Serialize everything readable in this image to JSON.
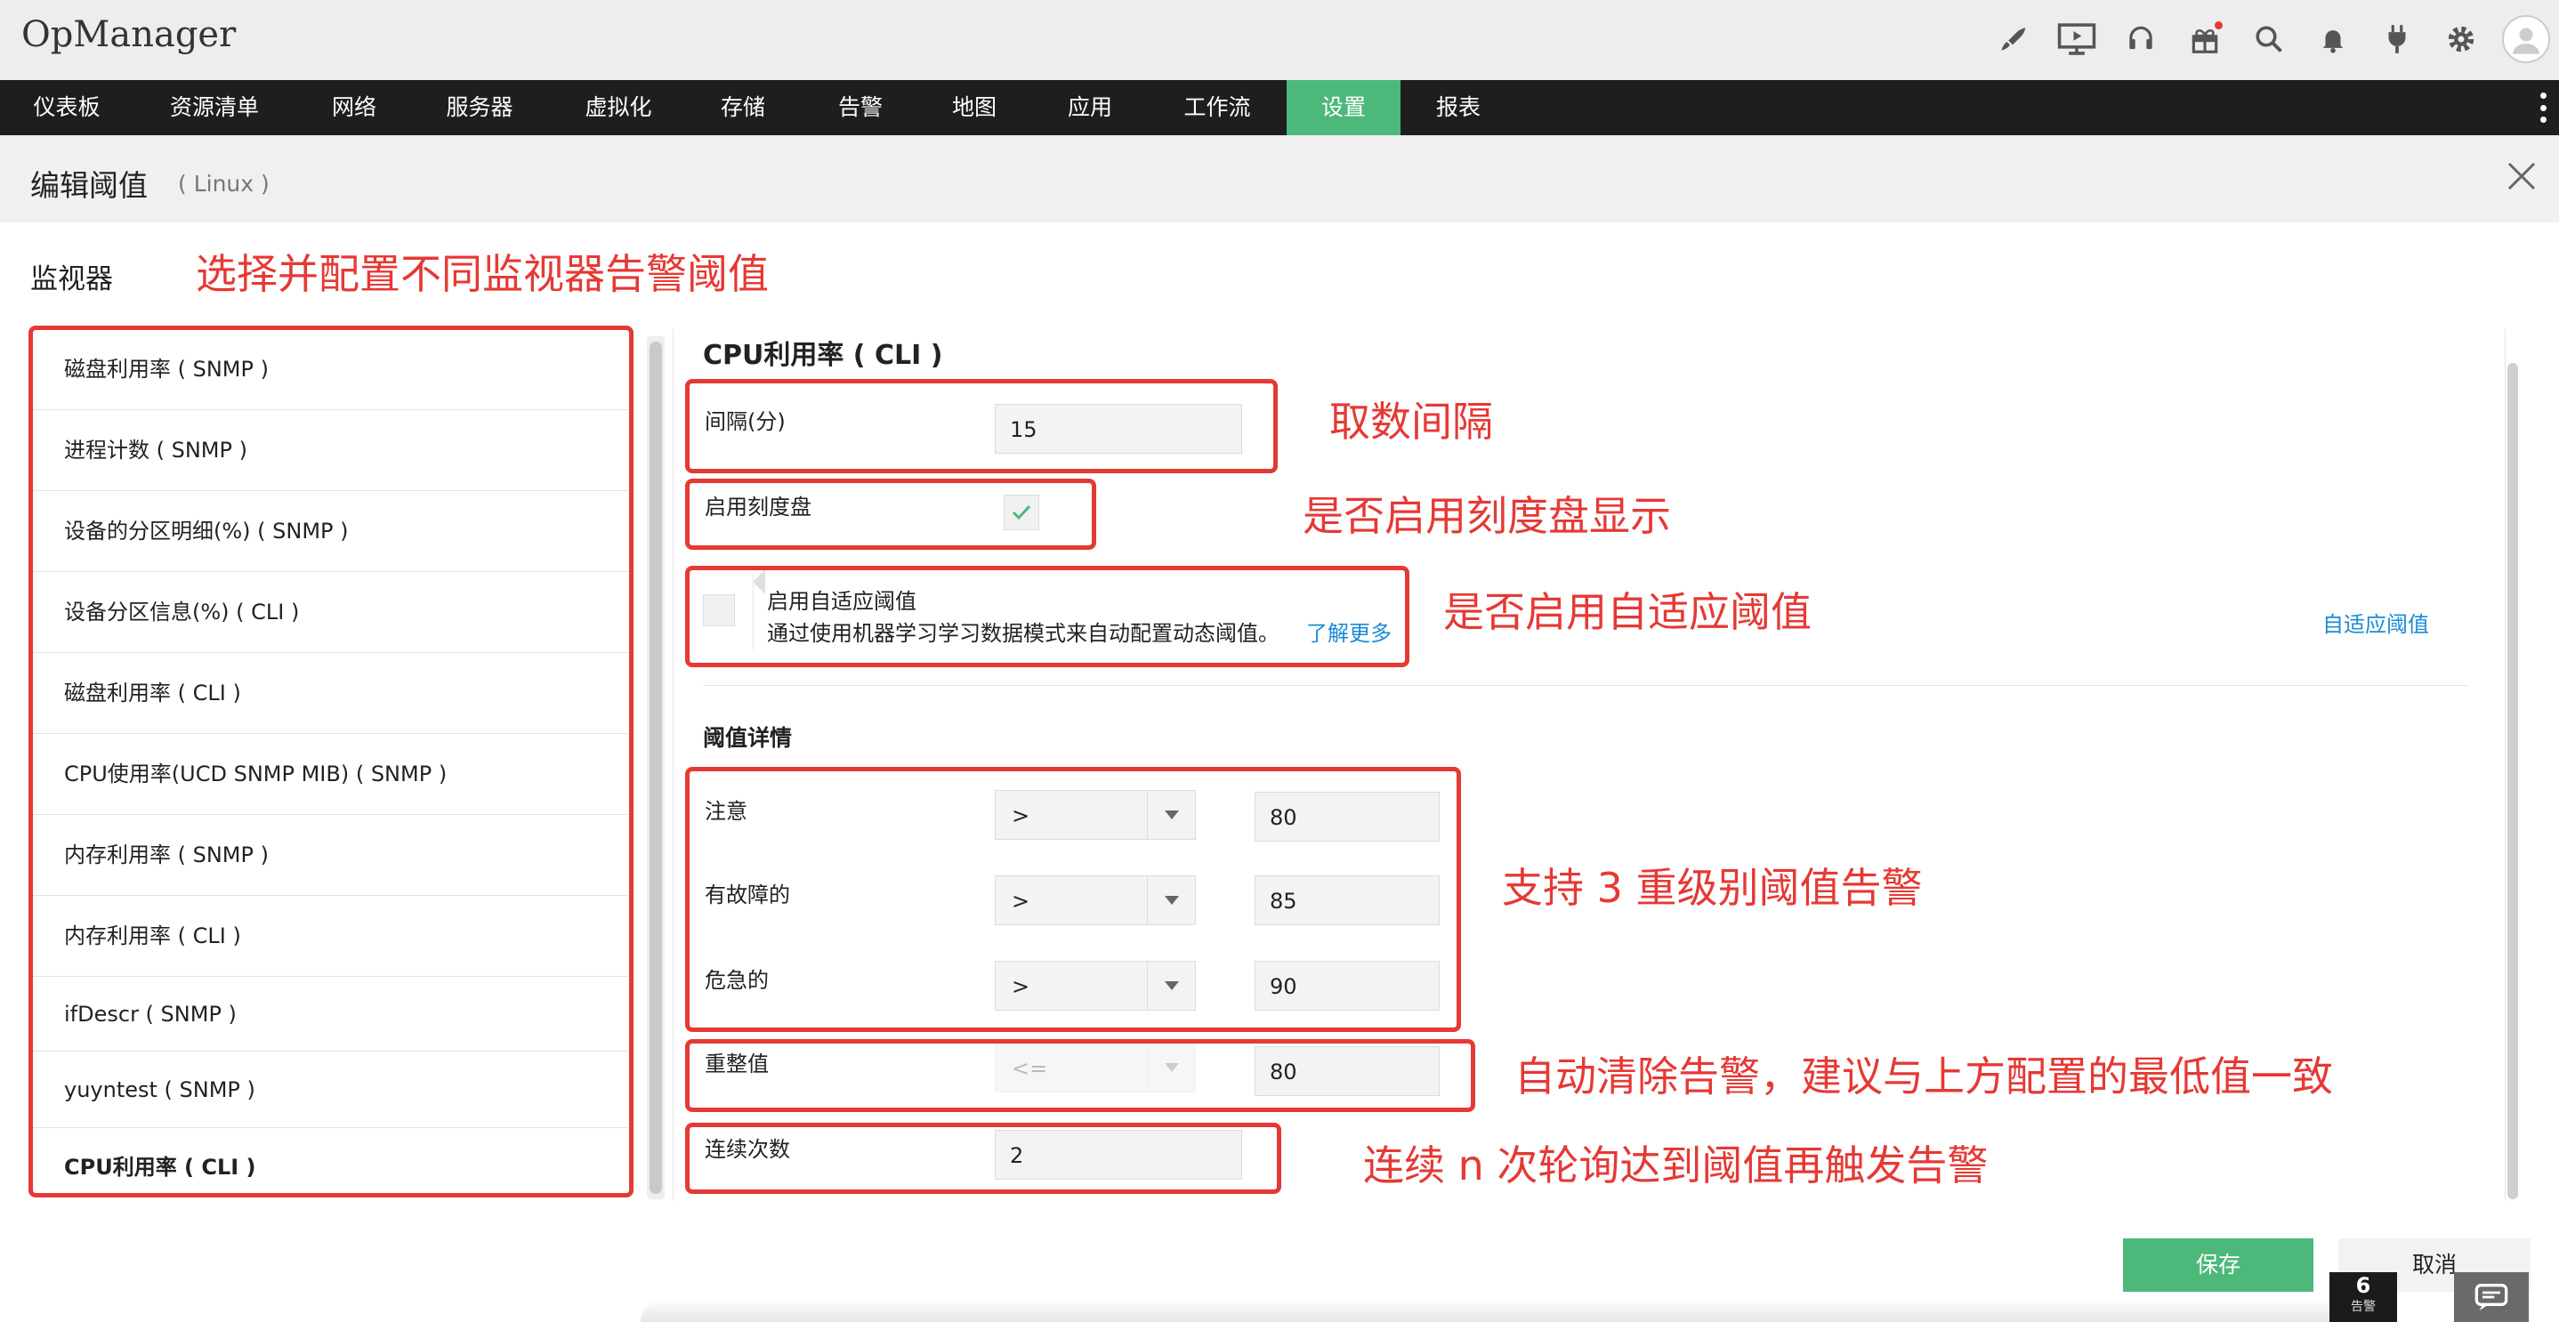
{
  "app": {
    "name": "OpManager"
  },
  "topbar": {
    "icons": [
      "rocket-icon",
      "presentation-icon",
      "headset-icon",
      "gift-icon",
      "search-icon",
      "bell-icon",
      "plug-icon",
      "gear-icon",
      "user-avatar-icon"
    ]
  },
  "nav": {
    "items": [
      "仪表板",
      "资源清单",
      "网络",
      "服务器",
      "虚拟化",
      "存储",
      "告警",
      "地图",
      "应用",
      "工作流",
      "设置",
      "报表"
    ],
    "active": "设置"
  },
  "header": {
    "title": "编辑阈值",
    "subtitle": "( Linux )"
  },
  "monitors": {
    "title": "监视器",
    "items": [
      "磁盘利用率 ( SNMP )",
      "进程计数 ( SNMP )",
      "设备的分区明细(%) ( SNMP )",
      "设备分区信息(%) ( CLI )",
      "磁盘利用率 ( CLI )",
      "CPU使用率(UCD SNMP MIB) ( SNMP )",
      "内存利用率 ( SNMP )",
      "内存利用率 ( CLI )",
      "ifDescr ( SNMP )",
      "yuyntest ( SNMP )",
      "CPU利用率 ( CLI )"
    ],
    "selected": "CPU利用率 ( CLI )"
  },
  "form": {
    "title": "CPU利用率 ( CLI )",
    "interval_label": "间隔(分)",
    "interval_value": "15",
    "dial_label": "启用刻度盘",
    "adaptive_label": "启用自适应阈值",
    "adaptive_desc": "通过使用机器学习学习数据模式来自动配置动态阈值。",
    "learn_more": "了解更多",
    "adaptive_link": "自适应阈值",
    "threshold_title": "阈值详情",
    "attention_label": "注意",
    "attention_op": ">",
    "attention_value": "80",
    "trouble_label": "有故障的",
    "trouble_op": ">",
    "trouble_value": "85",
    "critical_label": "危急的",
    "critical_op": ">",
    "critical_value": "90",
    "rearm_label": "重整值",
    "rearm_op": "<=",
    "rearm_value": "80",
    "consecutive_label": "连续次数",
    "consecutive_value": "2"
  },
  "annotations": {
    "a1": "选择并配置不同监视器告警阈值",
    "a2": "取数间隔",
    "a3": "是否启用刻度盘显示",
    "a4": "是否启用自适应阈值",
    "a5": "支持 3 重级别阈值告警",
    "a6": "自动清除告警，建议与上方配置的最低值一致",
    "a7": "连续 n 次轮询达到阈值再触发告警"
  },
  "buttons": {
    "save": "保存",
    "cancel": "取消"
  },
  "footer": {
    "alarm_count": "6",
    "alarm_label": "告警"
  },
  "colors": {
    "accent": "#4cb97a",
    "annotation": "#e53935",
    "link": "#1a8bd4",
    "navbar": "#1e1e1e"
  }
}
